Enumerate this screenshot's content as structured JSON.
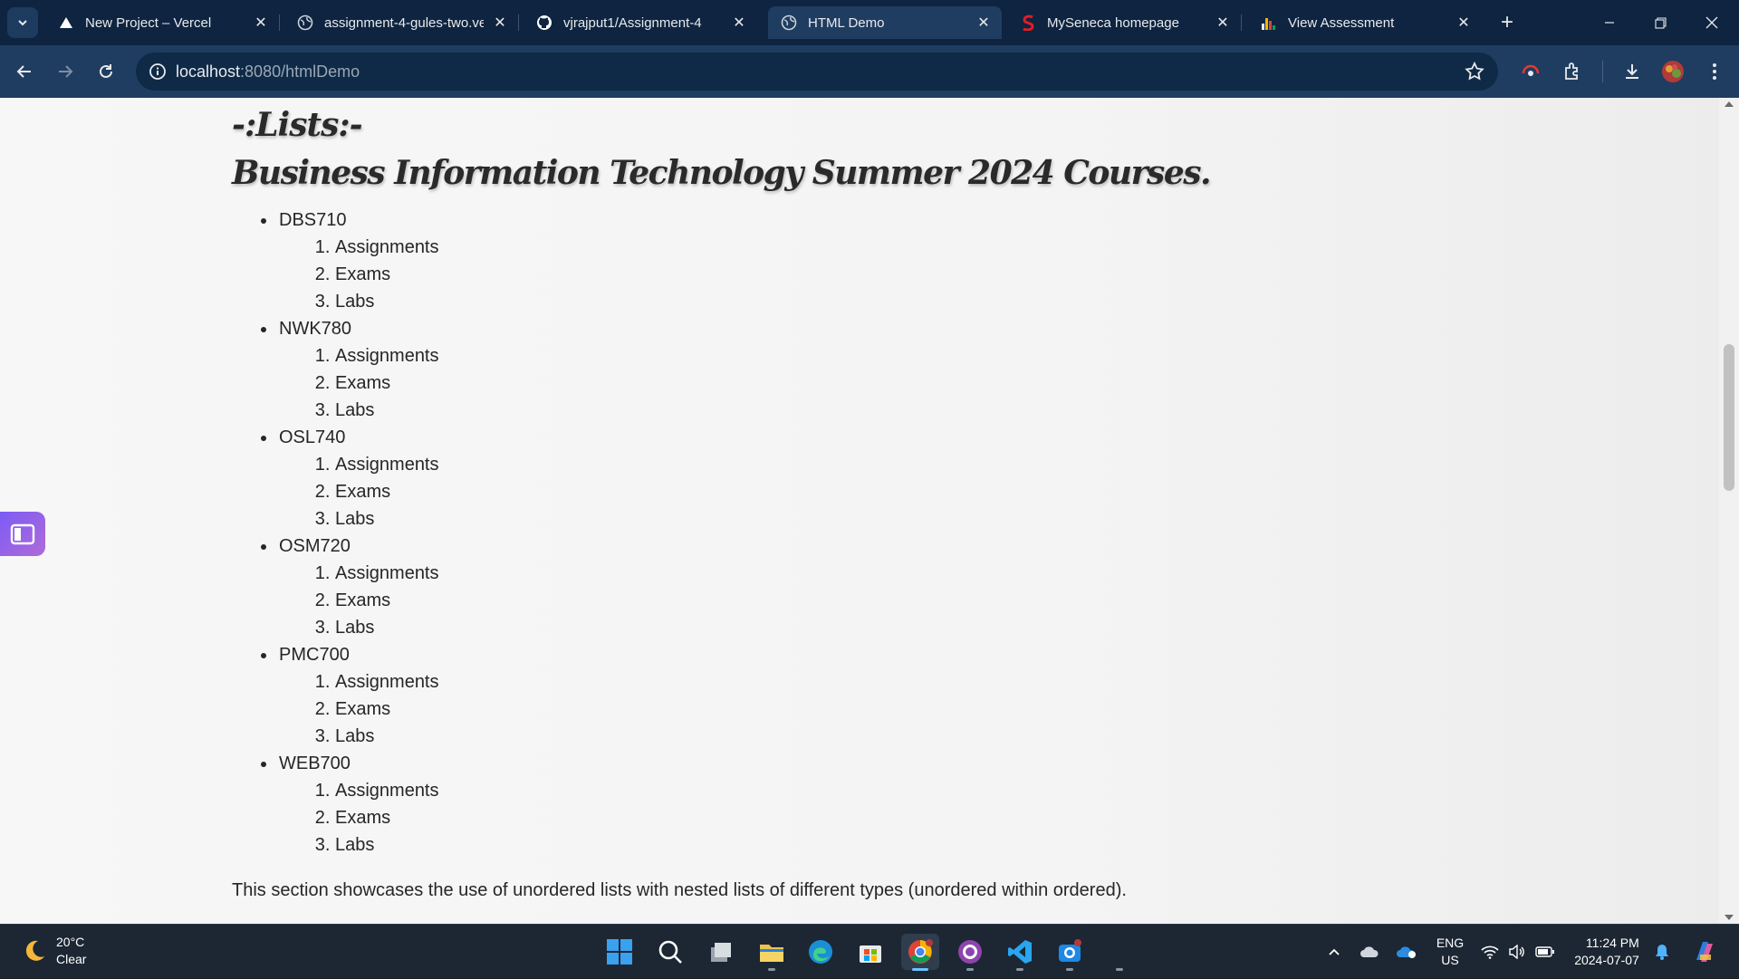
{
  "browser": {
    "tabs": [
      {
        "title": "New Project – Vercel",
        "icon": "vercel-icon",
        "active": false
      },
      {
        "title": "assignment-4-gules-two.ve",
        "icon": "globe-icon",
        "active": false
      },
      {
        "title": "vjrajput1/Assignment-4",
        "icon": "github-icon",
        "active": false
      },
      {
        "title": "HTML Demo",
        "icon": "globe-icon",
        "active": true
      },
      {
        "title": "MySeneca homepage",
        "icon": "seneca-icon",
        "active": false
      },
      {
        "title": "View Assessment",
        "icon": "bar-chart-icon",
        "active": false
      }
    ],
    "address": {
      "host": "localhost",
      "path": ":8080/htmlDemo"
    }
  },
  "page": {
    "section_heading": "-:Lists:-",
    "list_heading": "Business Information Technology Summer 2024 Courses.",
    "courses": [
      {
        "code": "DBS710",
        "items": [
          "Assignments",
          "Exams",
          "Labs"
        ]
      },
      {
        "code": "NWK780",
        "items": [
          "Assignments",
          "Exams",
          "Labs"
        ]
      },
      {
        "code": "OSL740",
        "items": [
          "Assignments",
          "Exams",
          "Labs"
        ]
      },
      {
        "code": "OSM720",
        "items": [
          "Assignments",
          "Exams",
          "Labs"
        ]
      },
      {
        "code": "PMC700",
        "items": [
          "Assignments",
          "Exams",
          "Labs"
        ]
      },
      {
        "code": "WEB700",
        "items": [
          "Assignments",
          "Exams",
          "Labs"
        ]
      }
    ],
    "description": "This section showcases the use of unordered lists with nested lists of different types (unordered within ordered)."
  },
  "taskbar": {
    "weather": {
      "temp": "20°C",
      "condition": "Clear"
    },
    "language": {
      "line1": "ENG",
      "line2": "US"
    },
    "clock": {
      "time": "11:24 PM",
      "date": "2024-07-07"
    }
  }
}
